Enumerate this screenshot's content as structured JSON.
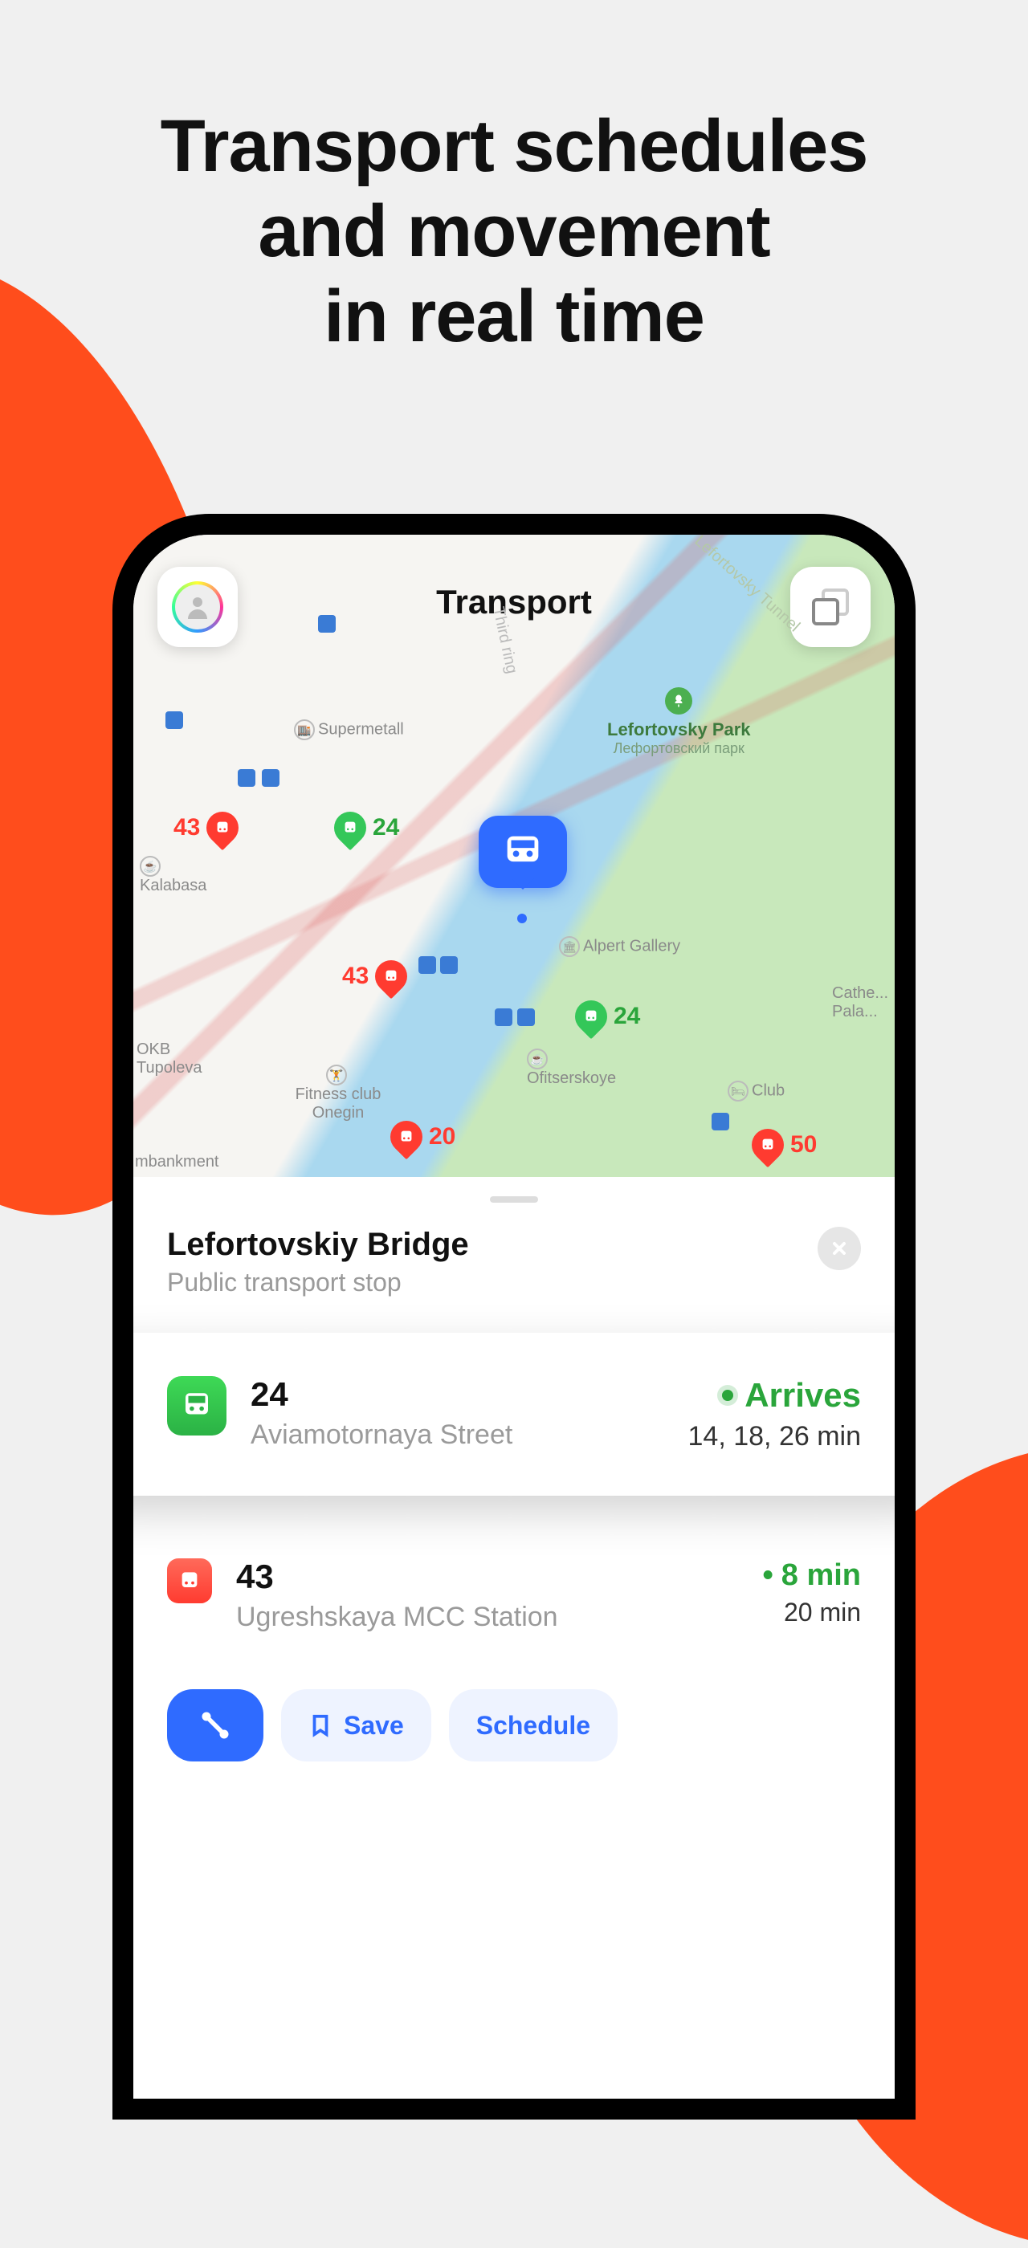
{
  "headline": {
    "l1": "Transport schedules",
    "l2": "and movement",
    "l3": "in real time"
  },
  "map": {
    "title": "Transport",
    "park": {
      "name": "Lefortovsky Park",
      "name_alt": "Лефортовский парк"
    },
    "pois": {
      "supermetall": "Supermetall",
      "kalabasa": "Kalabasa",
      "okb": "OKB Tupoleva",
      "onegin": "Fitness club Onegin",
      "mbankment": "mbankment",
      "alpert": "Alpert Gallery",
      "ofitserskoye": "Ofitserskoye",
      "club": "Club",
      "cathe": "Cathe... Pala...",
      "tunnel": "Lefortovsky Tunnel",
      "third": "Third ring"
    },
    "markers": {
      "r43a": "43",
      "r24a": "24",
      "r43b": "43",
      "r24b": "24",
      "r20": "20",
      "r50": "50"
    }
  },
  "sheet": {
    "title": "Lefortovskiy Bridge",
    "subtitle": "Public transport stop"
  },
  "routes": {
    "r1": {
      "number": "24",
      "dest": "Aviamotornaya Street",
      "status": "Arrives",
      "times": "14, 18, 26 min"
    },
    "r2": {
      "number": "43",
      "dest": "Ugreshskaya MCC Station",
      "next": "8 min",
      "later": "20 min"
    }
  },
  "actions": {
    "save": "Save",
    "schedule": "Schedule"
  }
}
